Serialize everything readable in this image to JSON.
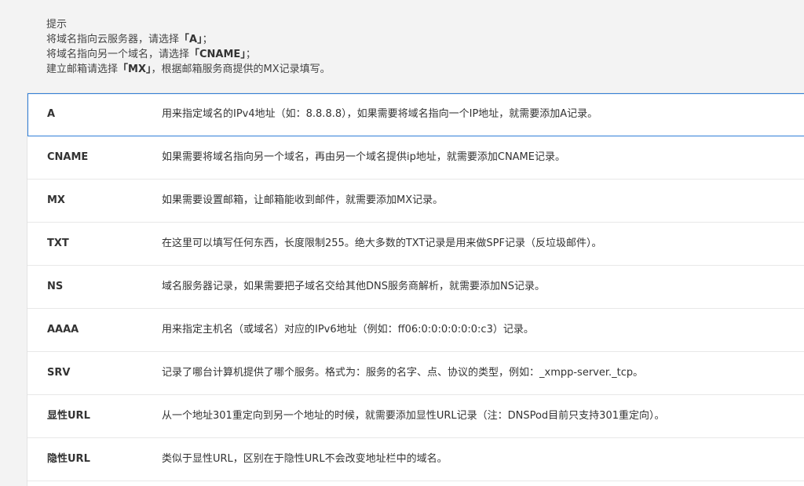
{
  "tip": {
    "title": "提示",
    "lines": [
      {
        "pre": "将域名指向云服务器，请选择",
        "key": "「A」",
        "post": "；"
      },
      {
        "pre": "将域名指向另一个域名，请选择",
        "key": "「CNAME」",
        "post": "；"
      },
      {
        "pre": "建立邮箱请选择",
        "key": "「MX」",
        "post": "，根据邮箱服务商提供的MX记录填写。"
      }
    ]
  },
  "records": [
    {
      "type": "A",
      "desc": "用来指定域名的IPv4地址（如：8.8.8.8），如果需要将域名指向一个IP地址，就需要添加A记录。"
    },
    {
      "type": "CNAME",
      "desc": "如果需要将域名指向另一个域名，再由另一个域名提供ip地址，就需要添加CNAME记录。"
    },
    {
      "type": "MX",
      "desc": "如果需要设置邮箱，让邮箱能收到邮件，就需要添加MX记录。"
    },
    {
      "type": "TXT",
      "desc": "在这里可以填写任何东西，长度限制255。绝大多数的TXT记录是用来做SPF记录（反垃圾邮件）。"
    },
    {
      "type": "NS",
      "desc": "域名服务器记录，如果需要把子域名交给其他DNS服务商解析，就需要添加NS记录。"
    },
    {
      "type": "AAAA",
      "desc": "用来指定主机名（或域名）对应的IPv6地址（例如：ff06:0:0:0:0:0:0:c3）记录。"
    },
    {
      "type": "SRV",
      "desc": "记录了哪台计算机提供了哪个服务。格式为：服务的名字、点、协议的类型，例如：_xmpp-server._tcp。"
    },
    {
      "type": "显性URL",
      "desc": "从一个地址301重定向到另一个地址的时候，就需要添加显性URL记录（注：DNSPod目前只支持301重定向）。"
    },
    {
      "type": "隐性URL",
      "desc": "类似于显性URL，区别在于隐性URL不会改变地址栏中的域名。"
    }
  ]
}
